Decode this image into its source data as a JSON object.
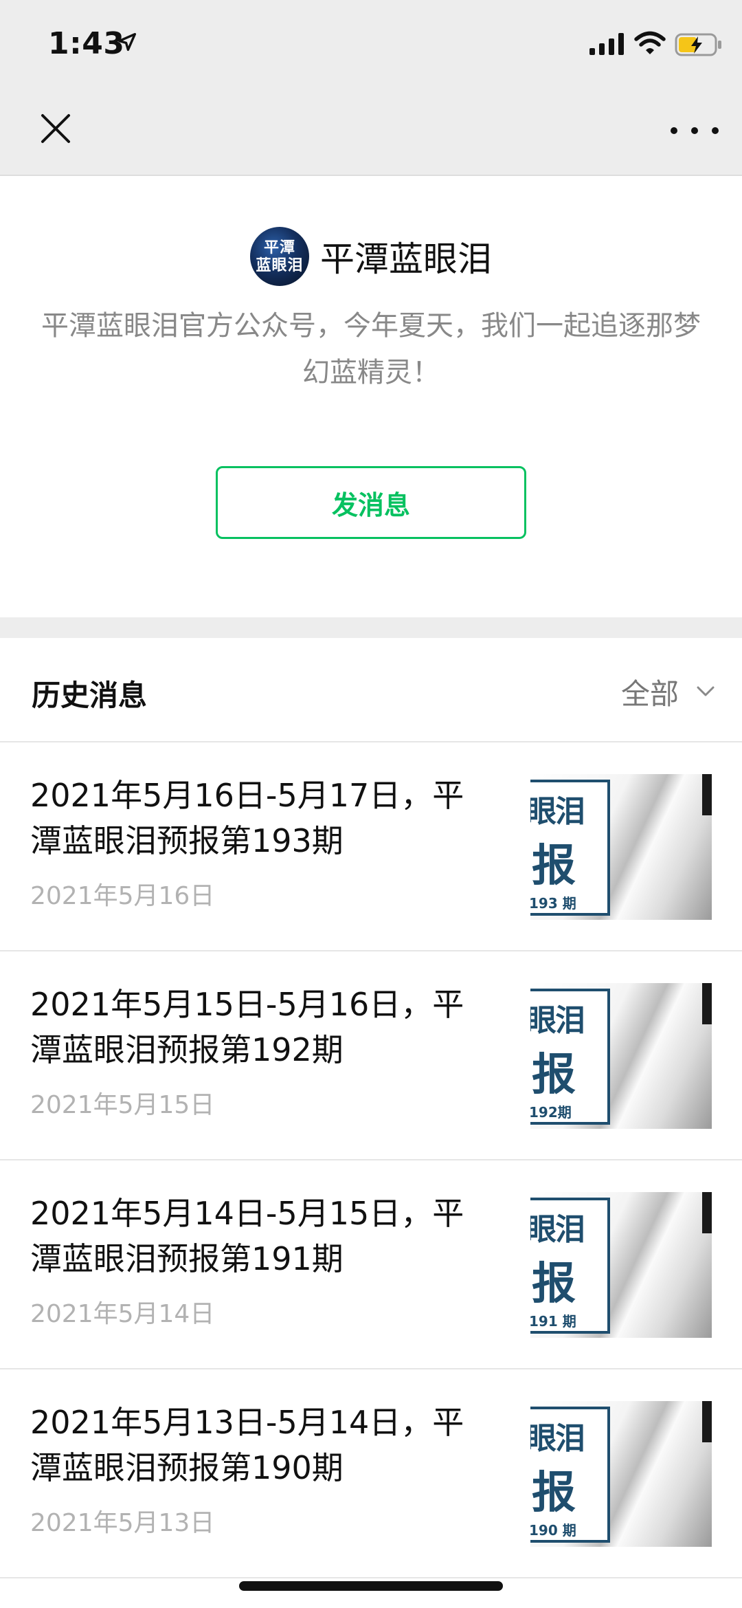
{
  "status_bar": {
    "time": "1:43",
    "location_icon": "location-arrow-icon",
    "signal_icon": "cellular-signal-icon",
    "wifi_icon": "wifi-icon",
    "battery_icon": "battery-charging-icon"
  },
  "nav": {
    "close_icon": "close-icon",
    "more_icon": "more-dots-icon"
  },
  "profile": {
    "avatar_text_line1": "平潭",
    "avatar_text_line2": "蓝眼泪",
    "name": "平潭蓝眼泪",
    "description": "平潭蓝眼泪官方公众号，今年夏天，我们一起追逐那梦幻蓝精灵！",
    "send_button_label": "发消息"
  },
  "history": {
    "title": "历史消息",
    "filter_label": "全部",
    "filter_icon": "chevron-down-icon",
    "items": [
      {
        "title": "2021年5月16日-5月17日，平潭蓝眼泪预报第193期",
        "date": "2021年5月16日",
        "thumb_line1": "眼泪",
        "thumb_line2": "报",
        "thumb_line3": "193 期"
      },
      {
        "title": "2021年5月15日-5月16日，平潭蓝眼泪预报第192期",
        "date": "2021年5月15日",
        "thumb_line1": "眼泪",
        "thumb_line2": "报",
        "thumb_line3": "192期"
      },
      {
        "title": "2021年5月14日-5月15日，平潭蓝眼泪预报第191期",
        "date": "2021年5月14日",
        "thumb_line1": "眼泪",
        "thumb_line2": "报",
        "thumb_line3": "191 期"
      },
      {
        "title": "2021年5月13日-5月14日，平潭蓝眼泪预报第190期",
        "date": "2021年5月13日",
        "thumb_line1": "眼泪",
        "thumb_line2": "报",
        "thumb_line3": "190 期"
      }
    ]
  },
  "colors": {
    "accent_green": "#07c160",
    "nav_background": "#ededed",
    "muted_text": "#888888",
    "date_text": "#b2b2b2",
    "thumb_blue": "#1f4e6e",
    "battery_yellow": "#f5c518"
  }
}
